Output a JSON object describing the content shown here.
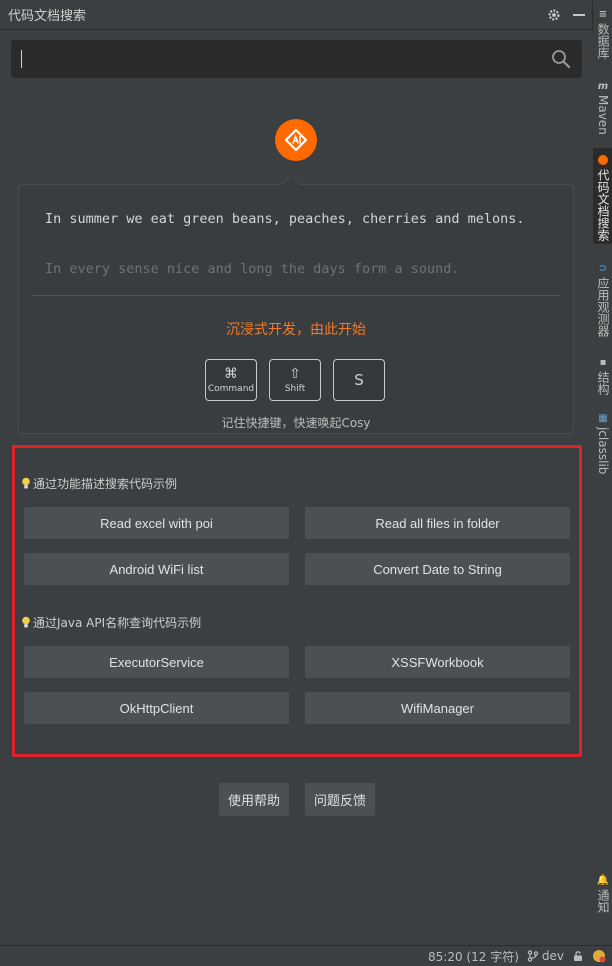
{
  "titlebar": {
    "title": "代码文档搜索"
  },
  "toolstrip": {
    "items": [
      {
        "label": "数据库"
      },
      {
        "label": "Maven"
      },
      {
        "label": "代码文档搜索"
      },
      {
        "label": "应用观测器"
      },
      {
        "label": "结构"
      },
      {
        "label": "jclasslib"
      },
      {
        "label": "通知"
      }
    ]
  },
  "search": {
    "value": "",
    "placeholder": ""
  },
  "card": {
    "quote1": "In summer we eat green beans, peaches, cherries and melons.",
    "quote2": "In every sense nice and long the days form a sound.",
    "slogan": "沉浸式开发，由此开始",
    "keys": [
      {
        "glyph": "⌘",
        "label": "Command"
      },
      {
        "glyph": "⇧",
        "label": "Shift"
      },
      {
        "glyph": "S",
        "label": ""
      }
    ],
    "hint": "记住快捷键，快速唤起Cosy"
  },
  "examples": {
    "section1": {
      "title": "通过功能描述搜索代码示例",
      "buttons": [
        "Read excel with poi",
        "Read all files in folder",
        "Android WiFi list",
        "Convert Date to String"
      ]
    },
    "section2": {
      "title": "通过Java API名称查询代码示例",
      "buttons": [
        "ExecutorService",
        "XSSFWorkbook",
        "OkHttpClient",
        "WifiManager"
      ]
    }
  },
  "footer": {
    "help": "使用帮助",
    "feedback": "问题反馈"
  },
  "statusbar": {
    "position": "85:20 (12 字符)",
    "branch": "dev"
  },
  "colors": {
    "accent": "#ff6a00",
    "highlight": "#e0232a",
    "slogan": "#f07b2c"
  }
}
